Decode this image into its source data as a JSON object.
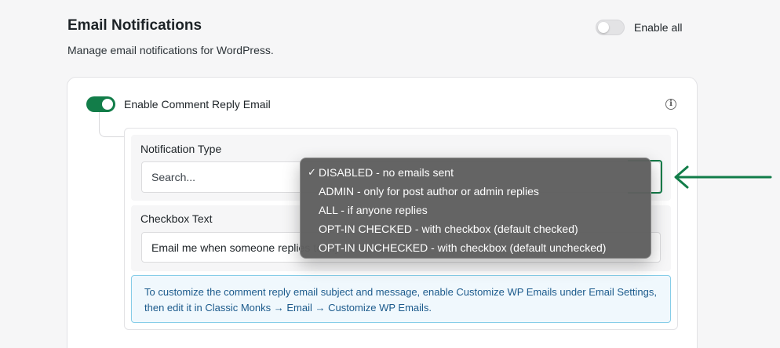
{
  "header": {
    "title": "Email Notifications",
    "description": "Manage email notifications for WordPress.",
    "enable_all_label": "Enable all",
    "enable_all_on": false
  },
  "comment_reply": {
    "label": "Enable Comment Reply Email",
    "enabled": true,
    "info_icon": "info-icon"
  },
  "notification_type": {
    "label": "Notification Type",
    "search_placeholder": "Search...",
    "options": [
      {
        "label": "DISABLED - no emails sent",
        "selected": true
      },
      {
        "label": "ADMIN - only for post author or admin replies",
        "selected": false
      },
      {
        "label": "ALL - if anyone replies",
        "selected": false
      },
      {
        "label": "OPT-IN CHECKED - with checkbox (default checked)",
        "selected": false
      },
      {
        "label": "OPT-IN UNCHECKED - with checkbox (default unchecked)",
        "selected": false
      }
    ],
    "check_glyph": "✓"
  },
  "checkbox_text": {
    "label": "Checkbox Text",
    "value": "Email me when someone replies to my comment"
  },
  "notice": {
    "text": "To customize the comment reply email subject and message, enable Customize WP Emails under Email Settings, then edit it in Classic Monks → Email → Customize WP Emails."
  },
  "colors": {
    "accent": "#127d49",
    "annotation_arrow": "#127d49",
    "notice_text": "#1b5a8c",
    "notice_border": "#86cde8"
  }
}
